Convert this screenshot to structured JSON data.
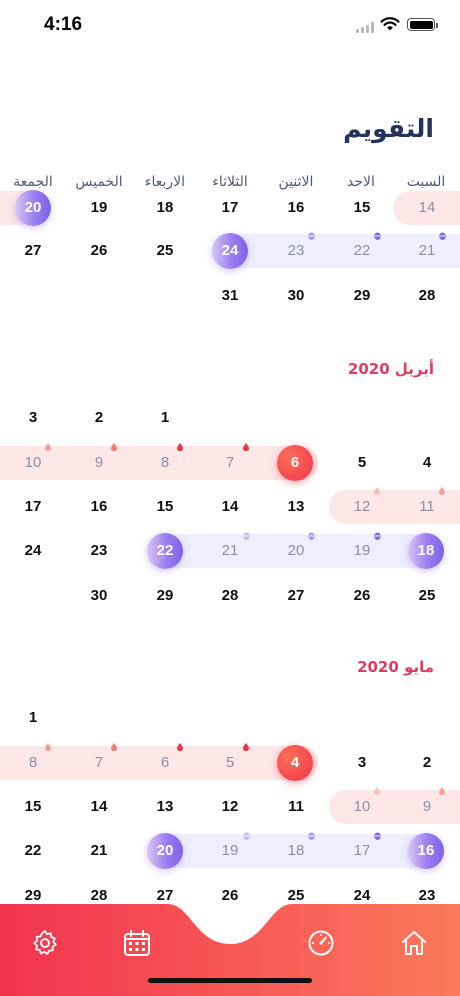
{
  "status_bar": {
    "time": "4:16"
  },
  "title": "التقويم",
  "weekdays": [
    "السبت",
    "الاحد",
    "الاثنين",
    "الثلاثاء",
    "الاربعاء",
    "الخميس",
    "الجمعة"
  ],
  "months": [
    {
      "name": ""
    },
    {
      "name": "أبريل 2020"
    },
    {
      "name": "مايو 2020"
    }
  ],
  "days": {
    "m1": [
      "14",
      "15",
      "16",
      "17",
      "18",
      "19",
      "20",
      "21",
      "22",
      "23",
      "24",
      "25",
      "26",
      "27",
      "28",
      "29",
      "30",
      "31"
    ],
    "m2": [
      "1",
      "2",
      "3",
      "4",
      "5",
      "6",
      "7",
      "8",
      "9",
      "10",
      "11",
      "12",
      "13",
      "14",
      "15",
      "16",
      "17",
      "18",
      "19",
      "20",
      "21",
      "22",
      "23",
      "24",
      "25",
      "26",
      "27",
      "28",
      "29",
      "30"
    ],
    "m3": [
      "1",
      "2",
      "3",
      "4",
      "5",
      "6",
      "7",
      "8",
      "9",
      "10",
      "11",
      "12",
      "13",
      "14",
      "15",
      "16",
      "17",
      "18",
      "19",
      "20",
      "21",
      "22",
      "23",
      "24",
      "25",
      "26",
      "27",
      "28",
      "29"
    ]
  },
  "colors": {
    "title": "#24325c",
    "month": "#e23b63",
    "period": "#ee3448",
    "ovulation": "#7e63e6",
    "nav_gradient_start": "#f2334f",
    "nav_gradient_end": "#fb7a5b"
  },
  "nav": {
    "items": [
      "settings-icon",
      "calendar-icon",
      "timer-icon",
      "home-icon"
    ]
  }
}
